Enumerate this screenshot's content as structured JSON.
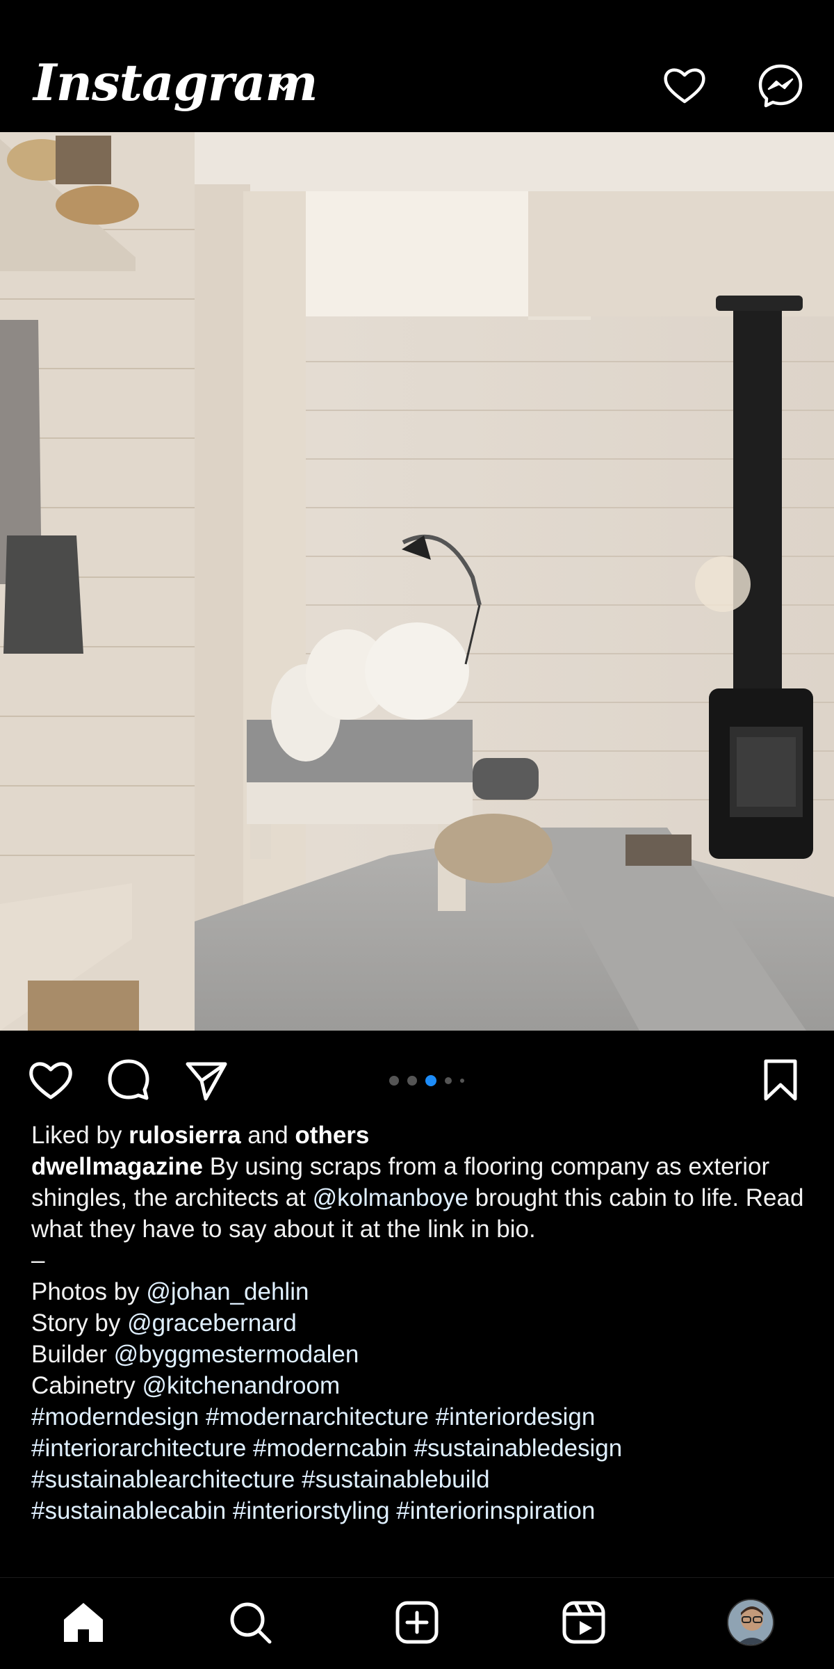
{
  "app": {
    "logo_text": "Instagram",
    "logo_dropdown_icon": "chevron-down-icon",
    "header_icons": [
      "heart-icon",
      "messenger-icon"
    ]
  },
  "post": {
    "image_alt_colors": {
      "wall": "#e6ddd2",
      "floor": "#a6a6a4",
      "stove": "#1c1c1c"
    },
    "carousel": {
      "total": 5,
      "active_index": 2
    },
    "actions": [
      "heart-icon",
      "comment-icon",
      "share-icon",
      "bookmark-icon"
    ],
    "likes": {
      "prefix": "Liked by ",
      "user": "rulosierra",
      "middle": " and ",
      "suffix": "others"
    },
    "caption": {
      "author": "dwellmagazine",
      "text_1": " By using scraps from a flooring company as exterior shingles, the architects at ",
      "mention_1": "@kolmanboye",
      "text_2": " brought this cabin to life. Read what they have to say about it at the link in bio.",
      "dash": "–",
      "credits": [
        {
          "label": "Photos by ",
          "handle": "@johan_dehlin"
        },
        {
          "label": "Story by ",
          "handle": "@gracebernard"
        },
        {
          "label": "Builder ",
          "handle": "@byggmestermodalen"
        },
        {
          "label": "Cabinetry ",
          "handle": "@kitchenandroom"
        }
      ],
      "hashtags_line_1": "#moderndesign #modernarchitecture #interiordesign",
      "hashtags_line_2": "#interiorarchitecture #moderncabin #sustainabledesign",
      "hashtags_line_3": "#sustainablearchitecture #sustainablebuild",
      "hashtags_line_4": "#sustainablecabin #interiorstyling #interiorinspiration"
    }
  },
  "bottom_nav": [
    "home-icon",
    "search-icon",
    "create-icon",
    "reels-icon",
    "profile-avatar"
  ],
  "colors": {
    "accent": "#1d8cf8",
    "background": "#000000",
    "text": "#f5f5f5"
  }
}
